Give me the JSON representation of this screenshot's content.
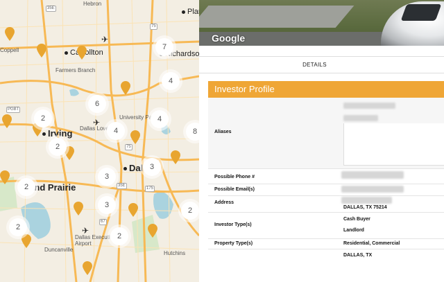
{
  "map": {
    "places": [
      {
        "name": "Hebron",
        "type": "small"
      },
      {
        "name": "Plan",
        "type": "normal"
      },
      {
        "name": "Carrollton",
        "type": "normal"
      },
      {
        "name": "Richardson",
        "type": "normal"
      },
      {
        "name": "Farmers Branch",
        "type": "small"
      },
      {
        "name": "University Park",
        "type": "small"
      },
      {
        "name": "Irving",
        "type": "big"
      },
      {
        "name": "Dallas Love Field",
        "type": "small"
      },
      {
        "name": "Dallas",
        "type": "big"
      },
      {
        "name": "Grand Prairie",
        "type": "big"
      },
      {
        "name": "Dallas Executive Airport",
        "type": "small"
      },
      {
        "name": "Duncanville",
        "type": "small"
      },
      {
        "name": "Hutchins",
        "type": "small"
      },
      {
        "name": "Coppell",
        "type": "small"
      }
    ],
    "clusters": [
      "7",
      "4",
      "6",
      "2",
      "4",
      "4",
      "8",
      "2",
      "3",
      "3",
      "2",
      "3",
      "2",
      "2",
      "2"
    ]
  },
  "streetview": {
    "brand": "Google"
  },
  "tabs": {
    "details_label": "DETAILS"
  },
  "profile": {
    "title": "Investor Profile",
    "rows": {
      "aliases": {
        "label": "Aliases"
      },
      "phone": {
        "label": "Possible Phone #"
      },
      "email": {
        "label": "Possible Email(s)"
      },
      "address": {
        "label": "Address",
        "value": "DALLAS, TX 75214"
      },
      "investor_type": {
        "label": "Investor Type(s)",
        "values": [
          "Cash Buyer",
          "Landlord"
        ]
      },
      "property_type": {
        "label": "Property Type(s)",
        "value": "Residential, Commercial"
      },
      "extra": {
        "value": "DALLAS, TX"
      }
    }
  },
  "colors": {
    "accent": "#efa636",
    "pin": "#e8a530"
  }
}
